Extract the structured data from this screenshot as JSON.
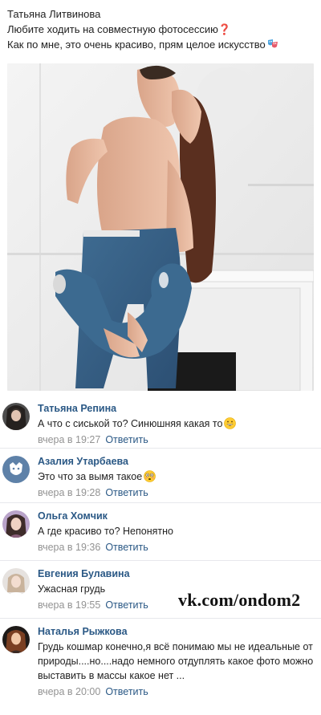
{
  "post": {
    "author": "Татьяна Литвинова",
    "line1": "Любите ходить на совместную фотосессию",
    "line1_emoji": "❓",
    "line2": "Как по мне, это очень красиво, прям целое искусство",
    "line2_emoji": "theater-masks-icon"
  },
  "comments": [
    {
      "name": "Татьяна Репина",
      "text": "А что с сиськой то? Синюшняя какая то",
      "emoji": "grinning-face-icon",
      "time": "вчера в 19:27",
      "reply": "Ответить"
    },
    {
      "name": "Азалия Утарбаева",
      "text": "Это что за вымя такое",
      "emoji": "flushed-face-icon",
      "time": "вчера в 19:28",
      "reply": "Ответить"
    },
    {
      "name": "Ольга Хомчик",
      "text": "А где красиво то? Непонятно",
      "time": "вчера в 19:36",
      "reply": "Ответить"
    },
    {
      "name": "Евгения Булавина",
      "text": "Ужасная грудь",
      "time": "вчера в 19:55",
      "reply": "Ответить"
    },
    {
      "name": "Наталья Рыжкова",
      "text": "Грудь кошмар конечно,я всё понимаю мы не идеальные от природы....но....надо немного отдуплять какое фото можно выставить в массы какое нет ...",
      "time": "вчера в 20:00",
      "reply": "Ответить"
    }
  ],
  "watermark": "vk.com/ondom2",
  "colors": {
    "link": "#2a5885",
    "meta": "#939393",
    "divider": "#e7e8ec"
  }
}
